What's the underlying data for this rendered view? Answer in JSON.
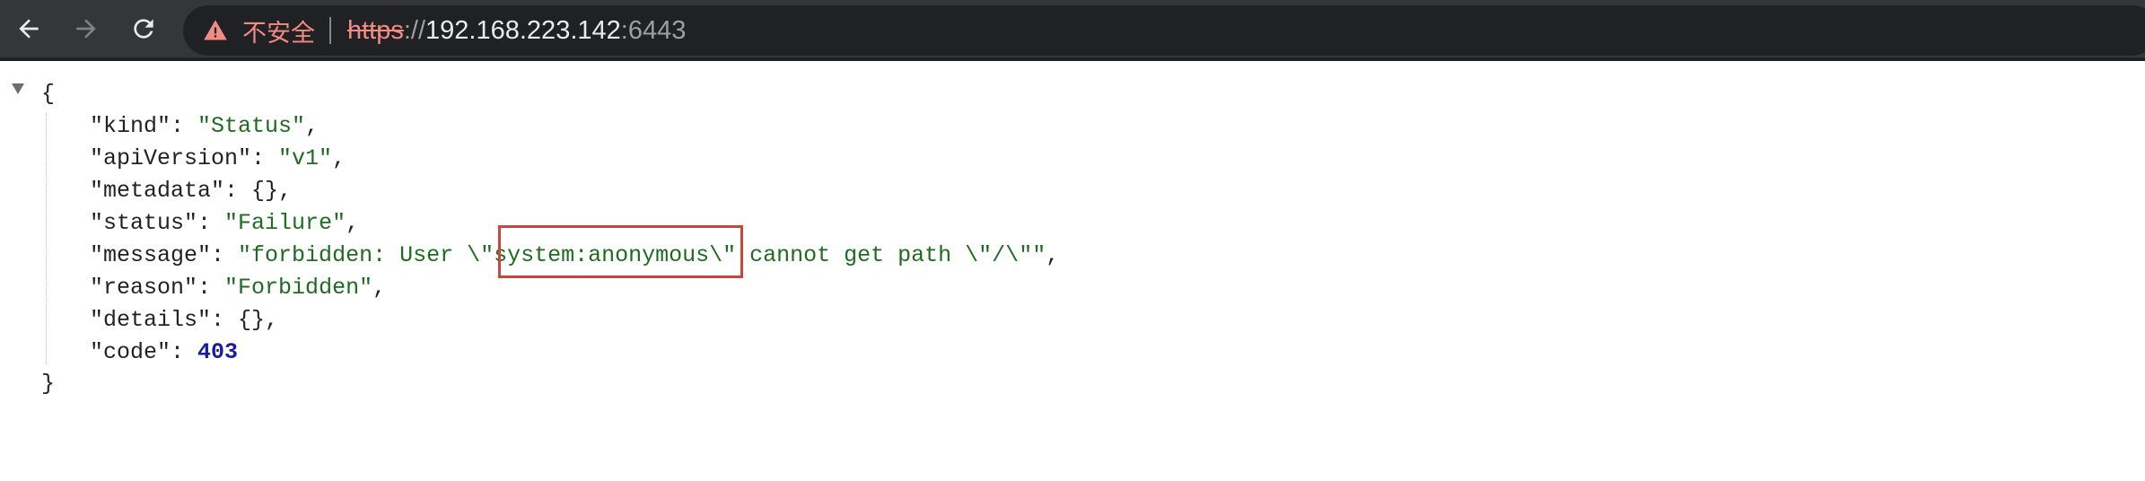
{
  "browser": {
    "nav": {
      "back_icon": "arrow-left",
      "forward_icon": "arrow-right",
      "reload_icon": "reload"
    },
    "omnibox": {
      "security_icon": "warning-triangle",
      "security_text": "不安全",
      "url_scheme": "https",
      "url_separator": "://",
      "url_host": "192.168.223.142",
      "url_port": ":6443"
    },
    "colors": {
      "toolbar_bg": "#35363a",
      "omnibox_bg": "#202124",
      "warning": "#f28b82"
    }
  },
  "json_view": {
    "open_brace": "{",
    "close_brace": "}",
    "fold_icon": "triangle-down",
    "properties": [
      {
        "key": "\"kind\"",
        "value": "\"Status\"",
        "type": "string",
        "comma": ","
      },
      {
        "key": "\"apiVersion\"",
        "value": "\"v1\"",
        "type": "string",
        "comma": ","
      },
      {
        "key": "\"metadata\"",
        "value": "{}",
        "type": "object",
        "comma": ","
      },
      {
        "key": "\"status\"",
        "value": "\"Failure\"",
        "type": "string",
        "comma": ","
      },
      {
        "key": "\"message\"",
        "value": "\"forbidden: User \\\"system:anonymous\\\" cannot get path \\\"/\\\"\"",
        "type": "string",
        "comma": ","
      },
      {
        "key": "\"reason\"",
        "value": "\"Forbidden\"",
        "type": "string",
        "comma": ","
      },
      {
        "key": "\"details\"",
        "value": "{}",
        "type": "object",
        "comma": ","
      },
      {
        "key": "\"code\"",
        "value": "403",
        "type": "number",
        "comma": ""
      }
    ],
    "highlight": {
      "label": "system:anonymous",
      "color": "#c8473b"
    }
  }
}
